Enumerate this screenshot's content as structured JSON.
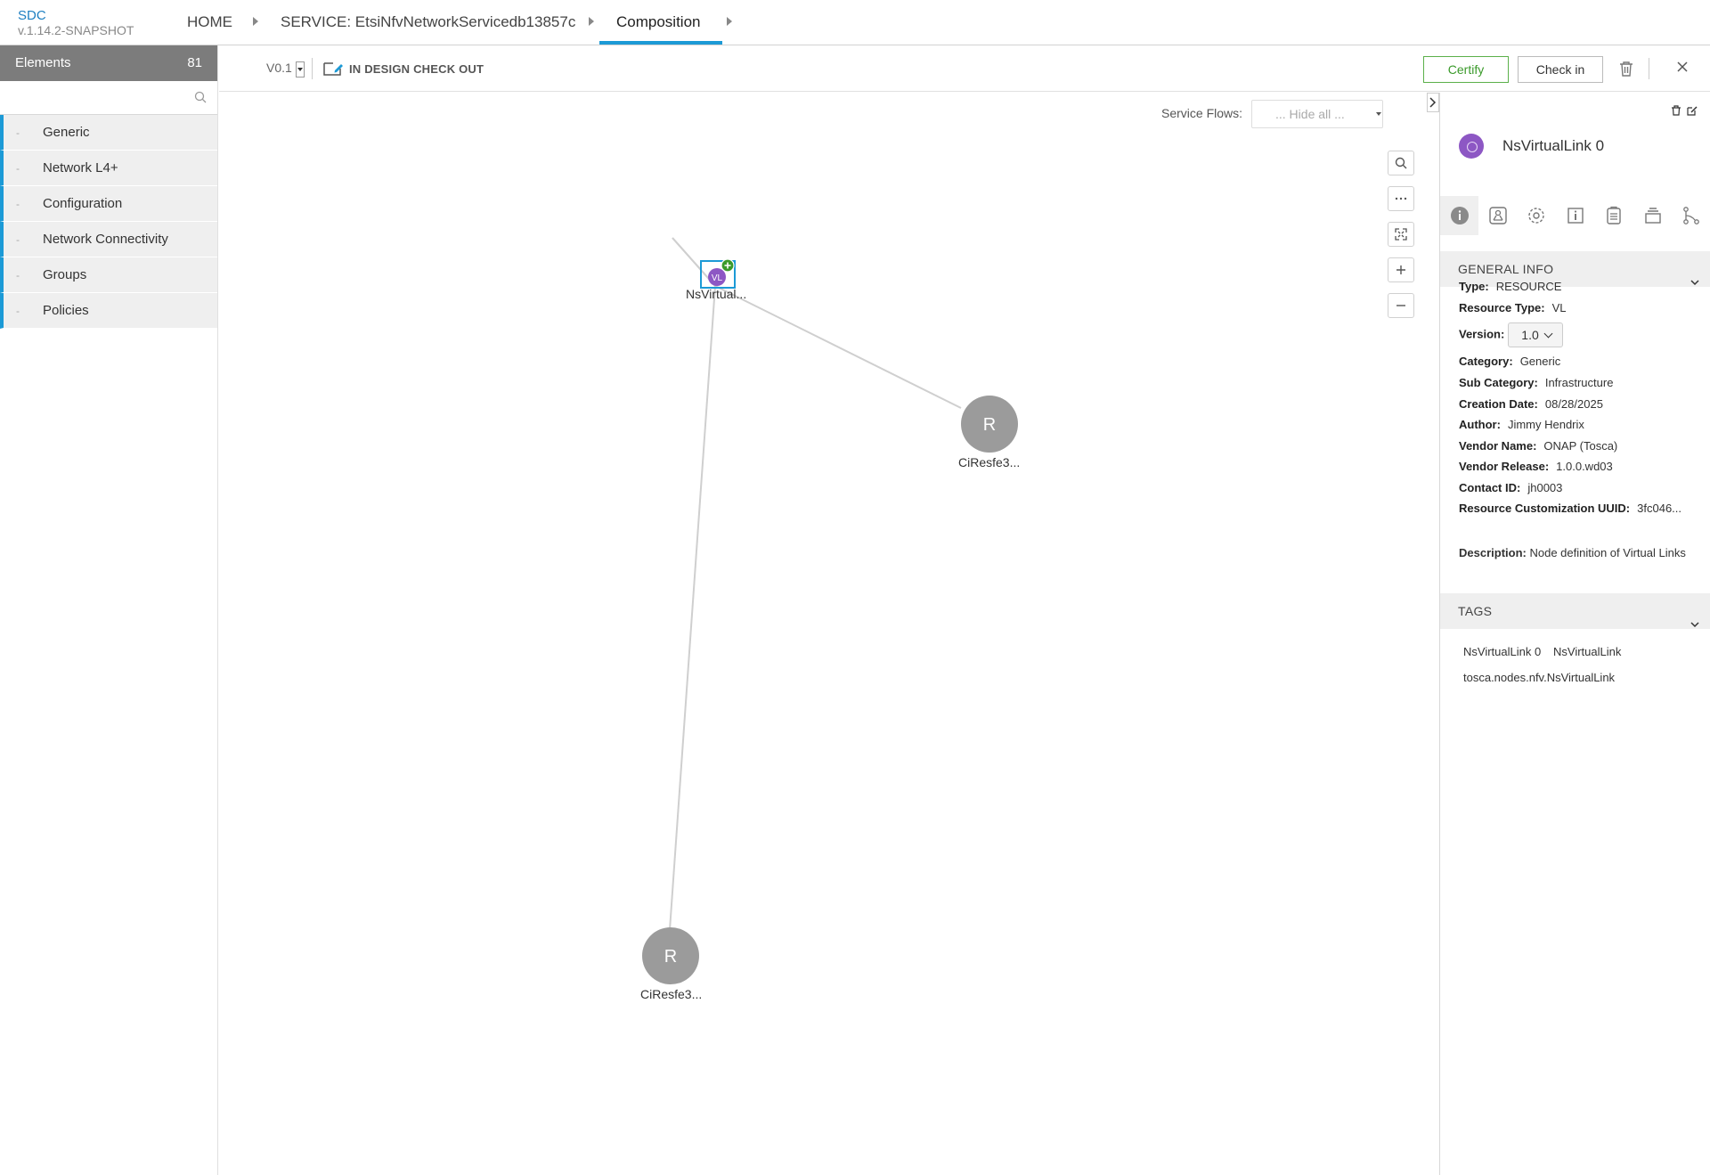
{
  "app": {
    "brand": "SDC",
    "version": "v.1.14.2-SNAPSHOT"
  },
  "breadcrumb": [
    {
      "label": "HOME"
    },
    {
      "label": "SERVICE: EtsiNfvNetworkServicedb13857c"
    },
    {
      "label": "Composition",
      "active": true
    }
  ],
  "palette": {
    "title": "Elements",
    "count": "81",
    "search_placeholder": "",
    "groups": [
      "Generic",
      "Network L4+",
      "Configuration",
      "Network Connectivity",
      "Groups",
      "Policies"
    ],
    "group_marker": "-"
  },
  "toolbar": {
    "version": "V0.1",
    "status": "IN DESIGN CHECK OUT",
    "certify_label": "Certify",
    "checkin_label": "Check in"
  },
  "canvas": {
    "service_flows_label": "Service Flows:",
    "service_flows_value": "... Hide all ...",
    "nodes": [
      {
        "label": "NsVirtual...",
        "icon_text": "VL",
        "type": "vl"
      },
      {
        "label": "CiResfe3...",
        "icon_text": "R",
        "type": "resource"
      },
      {
        "label": "CiResfe3...",
        "icon_text": "R",
        "type": "resource"
      }
    ],
    "zoom_controls": [
      "search-icon",
      "more-icon",
      "fit-icon",
      "plus-icon",
      "minus-icon"
    ]
  },
  "details": {
    "title": "NsVirtualLink 0",
    "general_info_title": "GENERAL INFO",
    "fields": {
      "type_label": "Type:",
      "type": "RESOURCE",
      "resource_type_label": "Resource Type:",
      "resource_type": "VL",
      "version_label": "Version:",
      "version": "1.0",
      "category_label": "Category:",
      "category": "Generic",
      "sub_category_label": "Sub Category:",
      "sub_category": "Infrastructure",
      "creation_date_label": "Creation Date:",
      "creation_date": "08/28/2025",
      "author_label": "Author:",
      "author": "Jimmy Hendrix",
      "vendor_name_label": "Vendor Name:",
      "vendor_name": "ONAP (Tosca)",
      "vendor_release_label": "Vendor Release:",
      "vendor_release": "1.0.0.wd03",
      "contact_id_label": "Contact ID:",
      "contact_id": "jh0003",
      "customization_uuid_label": "Resource Customization UUID:",
      "customization_uuid": "3fc046...",
      "description_label": "Description:",
      "description": "Node definition of Virtual Links"
    },
    "tags_title": "TAGS",
    "tags": [
      "NsVirtualLink 0",
      "NsVirtualLink",
      "tosca.nodes.nfv.NsVirtualLink"
    ]
  },
  "colors": {
    "accent": "#1c9ad6",
    "certify": "#5bb04a",
    "vl_node": "#8d57c4",
    "resource_node": "#9b9b9b",
    "header_gray": "#7c7c7c"
  }
}
